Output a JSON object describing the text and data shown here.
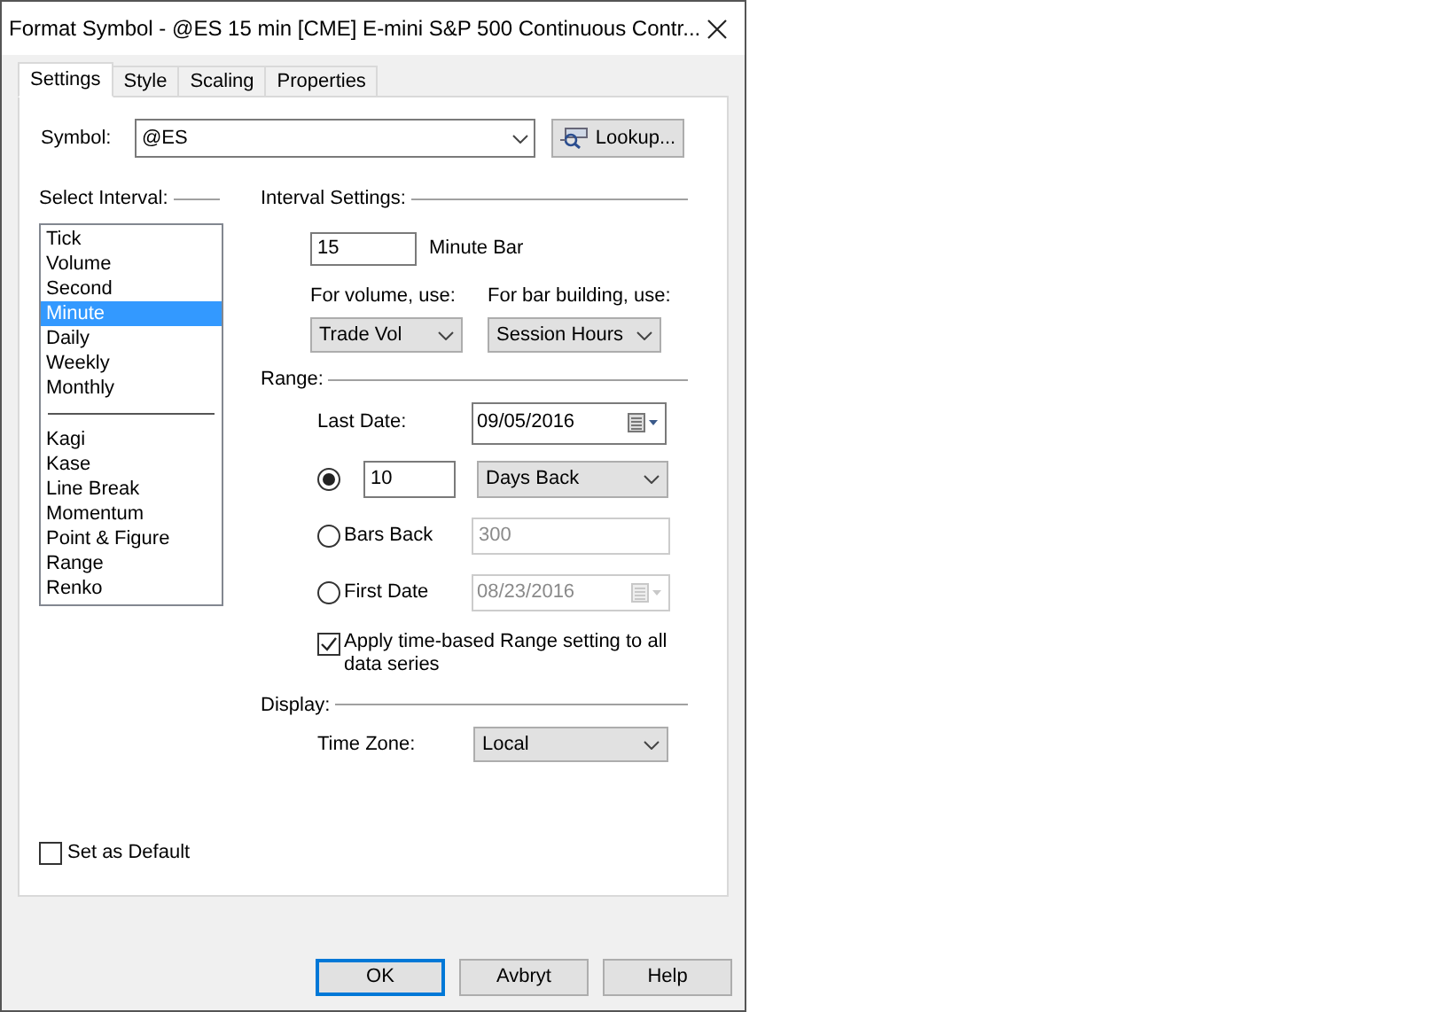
{
  "window": {
    "title": "Format Symbol - @ES 15 min [CME] E-mini S&P 500 Continuous Contr..."
  },
  "tabs": [
    {
      "label": "Settings",
      "selected": true
    },
    {
      "label": "Style",
      "selected": false
    },
    {
      "label": "Scaling",
      "selected": false
    },
    {
      "label": "Properties",
      "selected": false
    }
  ],
  "symbol": {
    "label": "Symbol:",
    "value": "@ES"
  },
  "lookup_button": {
    "label": "Lookup..."
  },
  "interval_list": {
    "label": "Select Interval:",
    "groups": [
      [
        {
          "label": "Tick",
          "selected": false
        },
        {
          "label": "Volume",
          "selected": false
        },
        {
          "label": "Second",
          "selected": false
        },
        {
          "label": "Minute",
          "selected": true
        },
        {
          "label": "Daily",
          "selected": false
        },
        {
          "label": "Weekly",
          "selected": false
        },
        {
          "label": "Monthly",
          "selected": false
        }
      ],
      [
        {
          "label": "Kagi",
          "selected": false
        },
        {
          "label": "Kase",
          "selected": false
        },
        {
          "label": "Line Break",
          "selected": false
        },
        {
          "label": "Momentum",
          "selected": false
        },
        {
          "label": "Point & Figure",
          "selected": false
        },
        {
          "label": "Range",
          "selected": false
        },
        {
          "label": "Renko",
          "selected": false
        }
      ]
    ]
  },
  "interval_settings": {
    "heading": "Interval Settings:",
    "bar_size": {
      "value": "15",
      "label": "Minute Bar"
    },
    "volume": {
      "label": "For volume, use:",
      "value": "Trade Vol"
    },
    "bar_building": {
      "label": "For bar building, use:",
      "value": "Session Hours"
    }
  },
  "range": {
    "heading": "Range:",
    "last_date": {
      "label": "Last Date:",
      "value": "09/05/2016"
    },
    "options": [
      {
        "kind": "count",
        "selected": true,
        "value": "10",
        "unit": "Days Back"
      },
      {
        "kind": "bars",
        "selected": false,
        "label": "Bars Back",
        "value": "300",
        "disabled": true
      },
      {
        "kind": "date",
        "selected": false,
        "label": "First Date",
        "value": "08/23/2016",
        "disabled": true
      }
    ],
    "apply_all": {
      "label": "Apply time-based Range setting to all data series",
      "checked": true
    }
  },
  "display": {
    "heading": "Display:",
    "time_zone": {
      "label": "Time Zone:",
      "value": "Local"
    }
  },
  "set_default": {
    "label": "Set as Default",
    "checked": false
  },
  "buttons": [
    {
      "label": "OK",
      "default": true
    },
    {
      "label": "Avbryt",
      "default": false
    },
    {
      "label": "Help",
      "default": false
    }
  ]
}
